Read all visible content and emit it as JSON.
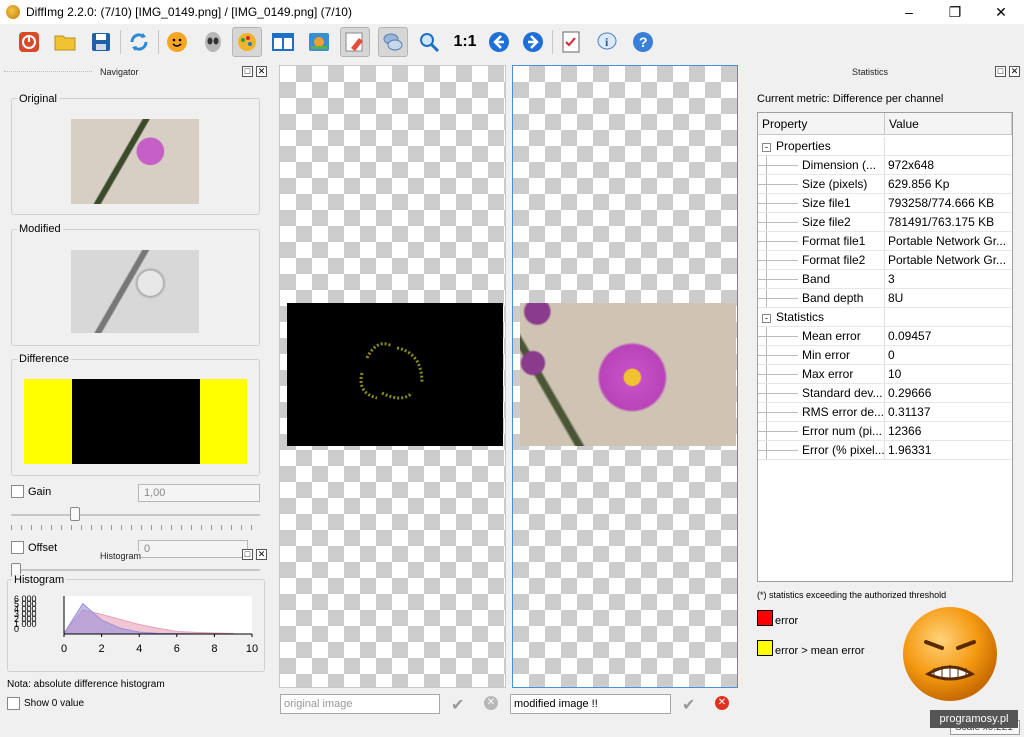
{
  "window": {
    "title": "DiffImg 2.2.0:  (7/10) [IMG_0149.png] / [IMG_0149.png] (7/10)",
    "minimize": "–",
    "maximize": "❐",
    "close": "✕"
  },
  "toolbar": {
    "icons": [
      "power-icon",
      "folder-open-icon",
      "save-icon",
      "refresh-icon",
      "smiley-icon",
      "alien-icon",
      "palette-icon",
      "split-view-icon",
      "image-view-icon",
      "eraser-icon",
      "chat-bubbles-icon",
      "zoom-icon",
      "zoom-1-1-icon",
      "arrow-left-icon",
      "arrow-right-icon",
      "checklist-icon",
      "info-icon",
      "help-icon"
    ],
    "zoom_label": "1:1"
  },
  "navigator": {
    "title": "Navigator",
    "original_label": "Original",
    "modified_label": "Modified",
    "difference_label": "Difference"
  },
  "gain": {
    "label": "Gain",
    "value": "1,00"
  },
  "offset": {
    "label": "Offset",
    "value": "0"
  },
  "histogram": {
    "dock_title": "Histogram",
    "label": "Histogram",
    "note": "Nota: absolute difference histogram",
    "show_zero_label": "Show 0 value"
  },
  "chart_data": {
    "type": "area",
    "title": "",
    "xlabel": "",
    "ylabel": "",
    "x_ticks": [
      "0",
      "2",
      "4",
      "6",
      "8",
      "10"
    ],
    "y_ticks": [
      "6 000",
      "5 000",
      "4 000",
      "3 000",
      "2 000",
      "1 000",
      "0"
    ],
    "xlim": [
      0,
      10
    ],
    "ylim": [
      0,
      6000
    ],
    "x": [
      0,
      1,
      2,
      3,
      4,
      5,
      6,
      7,
      8,
      9
    ],
    "series": [
      {
        "color": "#e8a0b8",
        "values": [
          200,
          3800,
          3100,
          2300,
          1500,
          900,
          400,
          250,
          150,
          80
        ]
      },
      {
        "color": "#9a90d8",
        "values": [
          100,
          4800,
          2200,
          900,
          300,
          100,
          50,
          20,
          10,
          5
        ]
      }
    ]
  },
  "viewers": {
    "original_path_placeholder": "original image",
    "modified_path_value": "modified image !!"
  },
  "statistics": {
    "dock_title": "Statistics",
    "current_metric": "Current metric: Difference per channel",
    "col_property": "Property",
    "col_value": "Value",
    "group_properties": "Properties",
    "properties": [
      {
        "name": "Dimension (...",
        "value": "972x648"
      },
      {
        "name": "Size (pixels)",
        "value": "629.856 Kp"
      },
      {
        "name": "Size file1",
        "value": "793258/774.666 KB"
      },
      {
        "name": "Size file2",
        "value": "781491/763.175 KB"
      },
      {
        "name": "Format file1",
        "value": "Portable Network Gr..."
      },
      {
        "name": "Format file2",
        "value": "Portable Network Gr..."
      },
      {
        "name": "Band",
        "value": "3"
      },
      {
        "name": "Band depth",
        "value": "8U"
      }
    ],
    "group_statistics": "Statistics",
    "stats": [
      {
        "name": "Mean error",
        "value": "0.09457"
      },
      {
        "name": "Min error",
        "value": "0"
      },
      {
        "name": "Max error",
        "value": "10"
      },
      {
        "name": "Standard dev...",
        "value": "0.29666"
      },
      {
        "name": "RMS error de...",
        "value": "0.31137"
      },
      {
        "name": "Error num (pi...",
        "value": "12366"
      },
      {
        "name": "Error (% pixel...",
        "value": "1.96331"
      }
    ],
    "threshold_note": "(*) statistics exceeding the authorized threshold",
    "legend_error": "error",
    "legend_mean": "error > mean error",
    "error_color": "#ff0000",
    "mean_color": "#ffff00"
  },
  "watermark": {
    "site": "programosy.pl",
    "scale": "Scale x0.221"
  }
}
